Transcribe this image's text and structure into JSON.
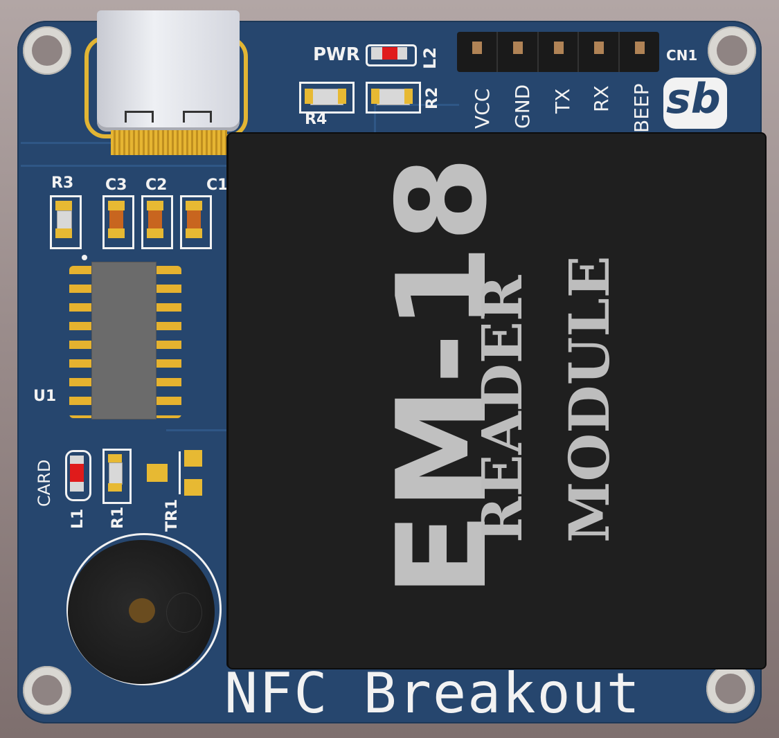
{
  "board": {
    "title": "NFC Breakout",
    "logo": "sb",
    "module": {
      "name": "EM-18",
      "line1": "READER",
      "line2": "MODULE"
    },
    "power_led_label": "PWR",
    "header_label": "CN1",
    "pins": [
      "VCC",
      "GND",
      "TX",
      "RX",
      "BEEP"
    ],
    "designators": {
      "r1": "R1",
      "r2": "R2",
      "r3": "R3",
      "r4": "R4",
      "c1": "C1",
      "c2": "C2",
      "c3": "C3",
      "l1": "L1",
      "l2": "L2",
      "u1": "U1",
      "tr1": "TR1",
      "card": "CARD"
    },
    "colors": {
      "pcb": "#26466e",
      "silkscreen": "#f2f2f2",
      "gold": "#e7b933",
      "module": "#1f1f1f",
      "led": "#e01b1b"
    }
  }
}
